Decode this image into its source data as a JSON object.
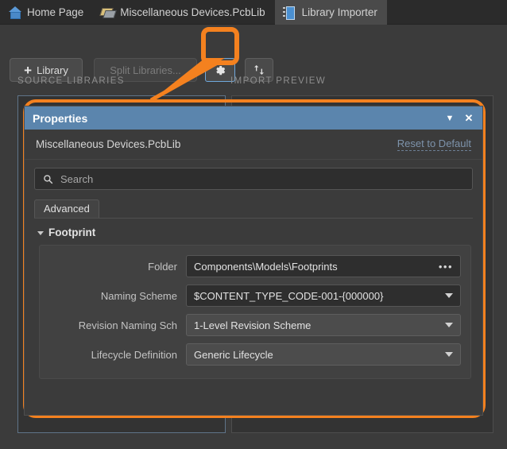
{
  "window": {
    "tabs": [
      {
        "label": "Home Page",
        "icon": "home-icon",
        "active": false
      },
      {
        "label": "Miscellaneous Devices.PcbLib",
        "icon": "library-icon",
        "active": false
      },
      {
        "label": "Library Importer",
        "icon": "chip-icon",
        "active": true
      }
    ]
  },
  "toolbar": {
    "library_button": "Library",
    "library_plus": "+",
    "split_libraries_button": "Split Libraries...",
    "settings_button_icon": "gear-icon",
    "swap_button_icon": "swap-icon"
  },
  "sections": {
    "source_libraries": "SOURCE LIBRARIES",
    "import_preview": "IMPORT PREVIEW"
  },
  "properties_panel": {
    "title": "Properties",
    "collapse_icon": "chevron-down-icon",
    "close_icon": "close-icon",
    "document_name": "Miscellaneous Devices.PcbLib",
    "reset_link": "Reset to Default",
    "search_placeholder": "Search",
    "search_value": "",
    "search_icon": "search-icon",
    "tabs": [
      {
        "label": "Advanced",
        "active": true
      }
    ],
    "group": {
      "title": "Footprint",
      "expanded": true,
      "fields": [
        {
          "label": "Folder",
          "value": "Components\\Models\\Footprints",
          "control": "input-with-browse",
          "affordance": "•••"
        },
        {
          "label": "Naming Scheme",
          "value": "$CONTENT_TYPE_CODE-001-{000000}",
          "control": "dropdown-dark",
          "affordance": "chevron-down-icon"
        },
        {
          "label": "Revision Naming Sch",
          "value": "1-Level Revision Scheme",
          "control": "dropdown-light",
          "affordance": "chevron-down-icon"
        },
        {
          "label": "Lifecycle Definition",
          "value": "Generic Lifecycle",
          "control": "dropdown-light",
          "affordance": "chevron-down-icon"
        }
      ]
    }
  },
  "annotation": {
    "highlight_color": "#F4811F",
    "description": "Orange callout connecting the settings gear button to the Properties panel"
  },
  "colors": {
    "accent_highlight": "#F4811F",
    "titlebar_blue": "#5B85AD",
    "selection_blue": "#6FA8DC",
    "window_background": "#3B3B3B",
    "tabbar_background": "#2B2B2B"
  }
}
